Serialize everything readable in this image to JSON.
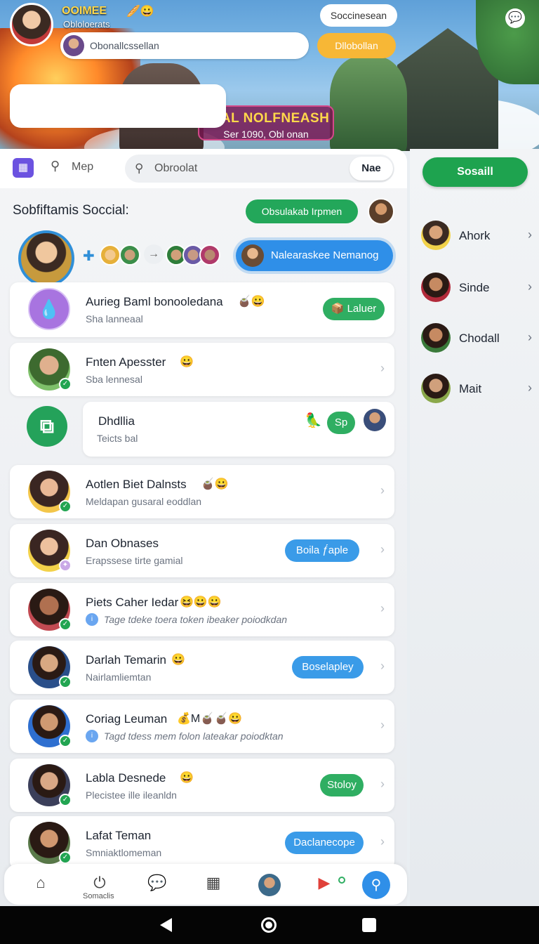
{
  "header": {
    "user_name": "OOIMEE",
    "user_emoji": "🥖😀",
    "user_sub": "Obloloerats",
    "search_value": "Obonallcssellan",
    "social_pill": "Soccinesean",
    "yellow_pill": "Dllobollan",
    "chat_icon": "chat-icon",
    "hero_title": "YEAL NOLFNEASH",
    "hero_sub": "Ser 1090, Obl onan"
  },
  "toolbar": {
    "search_label": "Mep",
    "field_placeholder": "Obroolat",
    "name_button": "Nae"
  },
  "section": {
    "title": "Sobfiftamis Soccial:",
    "pill": "Obsulakab Irpmen"
  },
  "story": {
    "blue_label": "Nalearaskee Nemanog"
  },
  "rows": [
    {
      "title": "Aurieg Baml bonooledana",
      "emoji": "🧉😀",
      "sub": "Sha lanneaal",
      "pill": "Laluer",
      "pill_icon": "📦"
    },
    {
      "title": "Fnten Apesster",
      "emoji": "😀",
      "sub": "Sba lennesal"
    },
    {
      "title": "Dhdllia",
      "sub": "Teicts bal",
      "pill": "Sp"
    },
    {
      "title": "Aotlen Biet Dalnsts",
      "emoji": "🧉😀",
      "sub": "Meldapan gusaral eoddlan"
    },
    {
      "title": "Dan Obnases",
      "sub": "Erapssese tirte gamial",
      "pill": "Boila ƒ́aple"
    },
    {
      "title": "Piets Caher Iedar",
      "emoji": "😆😀😀",
      "sub": "Tage tdeke toera token ibeaker poiodkdan"
    },
    {
      "title": "Darlah Temarin",
      "emoji": "😀",
      "sub": "Nairlamliemtan",
      "pill": "Boselapley"
    },
    {
      "title": "Coriag Leuman",
      "emoji": "💰M🧉🧉😀",
      "sub": "Tagd tdess mem folon lateakar poiodktan"
    },
    {
      "title": "Labla Desnede",
      "emoji": "😀",
      "sub": "Plecistee ille ileanldn",
      "pill": "Stoloy"
    },
    {
      "title": "Lafat Teman",
      "sub": "Smniaktlomeman",
      "pill": "Daclanecope"
    }
  ],
  "side": {
    "button": "Sosaill",
    "items": [
      {
        "name": "Ahork"
      },
      {
        "name": "Sinde"
      },
      {
        "name": "Chodall"
      },
      {
        "name": "Mait"
      }
    ]
  },
  "bottom_nav": {
    "label": "Somaclis"
  }
}
